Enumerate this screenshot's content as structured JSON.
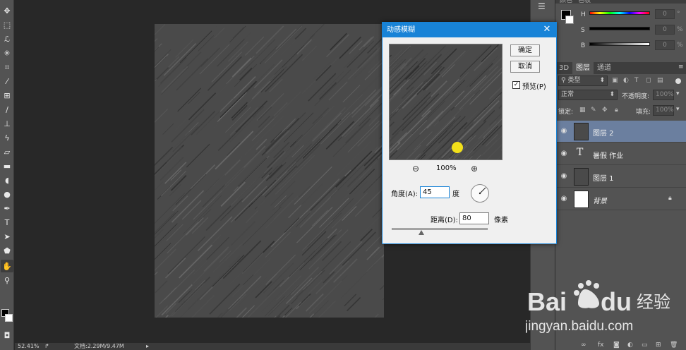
{
  "toolbar": {
    "tools": [
      {
        "icon": "move-icon",
        "glyph": "✥"
      },
      {
        "icon": "marquee-icon",
        "glyph": "⬚"
      },
      {
        "icon": "lasso-icon",
        "glyph": "ℒ"
      },
      {
        "icon": "magic-wand-icon",
        "glyph": "✳"
      },
      {
        "icon": "crop-icon",
        "glyph": "⌗"
      },
      {
        "icon": "eyedropper-icon",
        "glyph": "⁄"
      },
      {
        "icon": "healing-brush-icon",
        "glyph": "⊞"
      },
      {
        "icon": "brush-icon",
        "glyph": "∕"
      },
      {
        "icon": "clone-stamp-icon",
        "glyph": "⊥"
      },
      {
        "icon": "history-brush-icon",
        "glyph": "ϟ"
      },
      {
        "icon": "eraser-icon",
        "glyph": "▱"
      },
      {
        "icon": "gradient-icon",
        "glyph": "▬"
      },
      {
        "icon": "blur-icon",
        "glyph": "◖"
      },
      {
        "icon": "dodge-icon",
        "glyph": "●"
      },
      {
        "icon": "pen-icon",
        "glyph": "✒"
      },
      {
        "icon": "type-icon",
        "glyph": "T"
      },
      {
        "icon": "path-selection-icon",
        "glyph": "➤"
      },
      {
        "icon": "shape-icon",
        "glyph": "⬟"
      },
      {
        "icon": "hand-icon",
        "glyph": "✋"
      },
      {
        "icon": "zoom-icon",
        "glyph": "⚲"
      }
    ]
  },
  "statusbar": {
    "zoom": "52.41%",
    "doc_info": "文档:2.29M/9.47M"
  },
  "color_panel": {
    "tabs": [
      "颜色",
      "色板"
    ],
    "channels": [
      {
        "label": "H",
        "value": "0"
      },
      {
        "label": "S",
        "value": "0"
      },
      {
        "label": "B",
        "value": "0"
      }
    ]
  },
  "layers_panel": {
    "tabs": [
      "3D",
      "图层",
      "通道"
    ],
    "filter_kind": "类型",
    "blend_mode": "正常",
    "opacity_label": "不透明度:",
    "opacity_value": "100%",
    "lock_label": "锁定:",
    "fill_label": "填充:",
    "fill_value": "100%",
    "layers": [
      {
        "name": "图层 2",
        "selected": true,
        "kind": "texture"
      },
      {
        "name": "暑假 作业",
        "selected": false,
        "kind": "text"
      },
      {
        "name": "图层 1",
        "selected": false,
        "kind": "texture"
      },
      {
        "name": "背景",
        "selected": false,
        "kind": "background",
        "locked": true
      }
    ]
  },
  "dialog": {
    "title": "动感模糊",
    "ok_label": "确定",
    "cancel_label": "取消",
    "preview_label": "预览(P)",
    "preview_checked": true,
    "zoom_level": "100%",
    "angle_label": "角度(A):",
    "angle_value": "45",
    "angle_unit": "度",
    "distance_label": "距离(D):",
    "distance_value": "80",
    "distance_unit": "像素",
    "distance_slider_fraction": 0.31
  },
  "watermark": {
    "brand": "Bai du 经验",
    "url": "jingyan.baidu.com"
  },
  "colors": {
    "accent": "#1883d7",
    "selected_layer": "#6b7f9f",
    "cursor_dot": "#f2e01a"
  }
}
